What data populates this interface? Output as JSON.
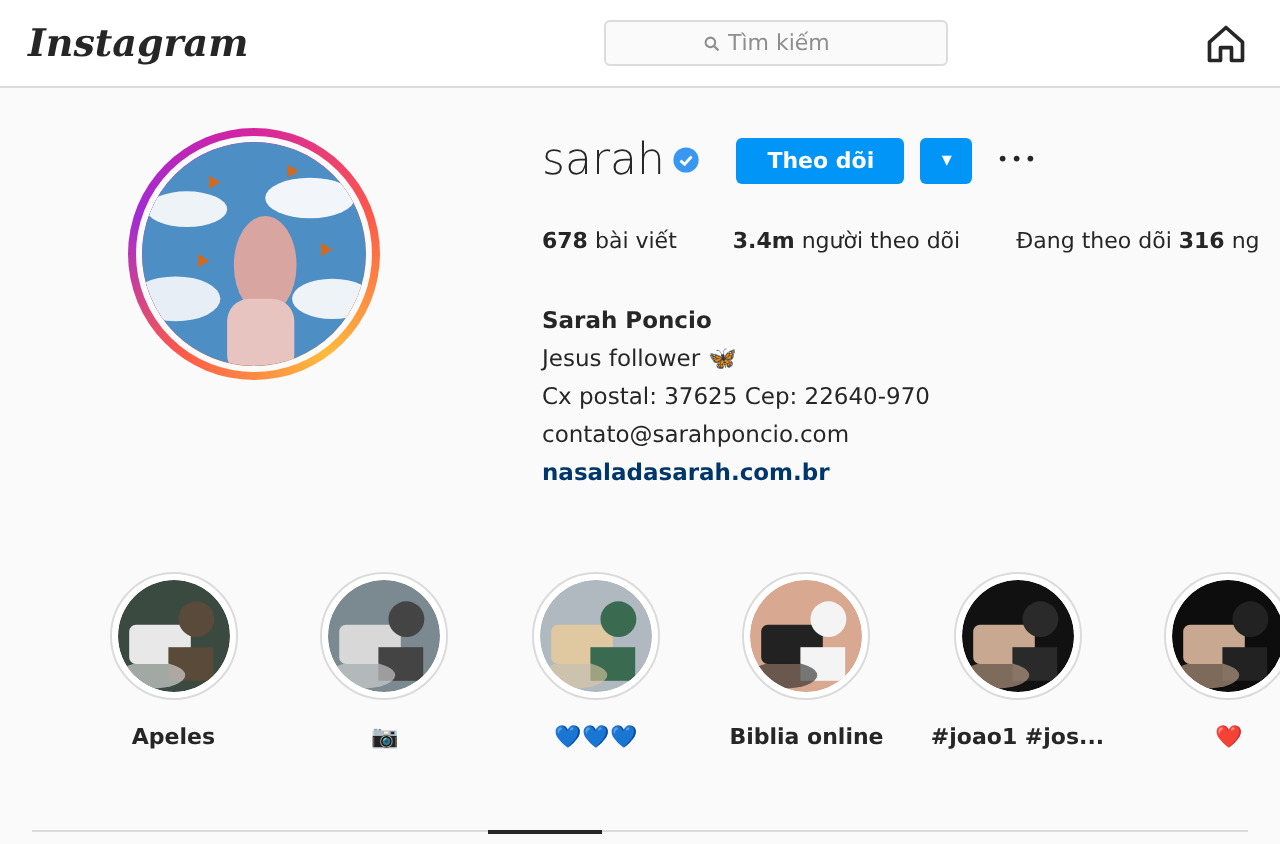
{
  "header": {
    "logo": "Instagram",
    "search": {
      "placeholder": "Tìm kiếm"
    }
  },
  "profile": {
    "username": "sarah",
    "verified": true,
    "follow_button": "Theo dõi",
    "dropdown_button": "▾",
    "more_button": "•••",
    "stats": [
      "**678** bài viết",
      "**3.4m** người theo dõi",
      "Đang theo dõi **316** ng"
    ],
    "name": "Sarah Poncio",
    "bio": [
      "Jesus follower 🦋",
      "Cx postal: 37625 Cep: 22640-970",
      "contato@sarahponcio.com"
    ],
    "link": "nasaladasarah.com.br"
  },
  "highlights": [
    {
      "label": "Apeles",
      "kind": "picture"
    },
    {
      "label": "📷",
      "kind": "picture"
    },
    {
      "label": "💙💙💙",
      "kind": "picture"
    },
    {
      "label": "Biblia online",
      "kind": "picture"
    },
    {
      "label": "#joao1 #jos...",
      "kind": "picture"
    },
    {
      "label": "❤️",
      "kind": "picture"
    }
  ],
  "tabs": [
    {
      "selected": true
    }
  ]
}
